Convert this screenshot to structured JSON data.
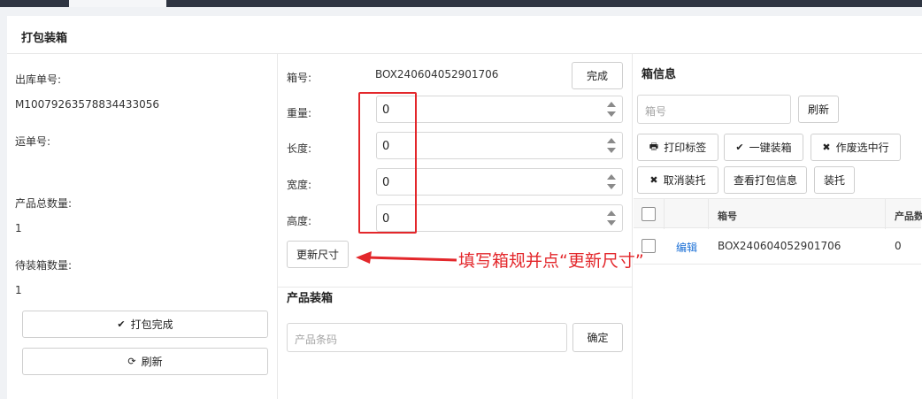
{
  "page": {
    "title": "打包装箱"
  },
  "left": {
    "outbound_label": "出库单号:",
    "outbound_value": "M100792635788344330​56",
    "waybill_label": "运单号:",
    "waybill_value": "",
    "total_qty_label": "产品总数量:",
    "total_qty_value": "1",
    "pending_qty_label": "待装箱数量:",
    "pending_qty_value": "1",
    "pack_done_label": "打包完成",
    "refresh_label": "刷新"
  },
  "box": {
    "box_no_label": "箱号:",
    "box_no_value": "BOX240604052901706",
    "complete_label": "完成",
    "weight_label": "重量:",
    "weight_value": "0",
    "length_label": "长度:",
    "length_value": "0",
    "width_label": "宽度:",
    "width_value": "0",
    "height_label": "高度:",
    "height_value": "0",
    "update_size_label": "更新尺寸"
  },
  "annotation": {
    "text": "填写箱规并点“更新尺寸”",
    "color": "#e3272b"
  },
  "product_packing": {
    "title": "产品装箱",
    "barcode_placeholder": "产品条码",
    "confirm_label": "确定"
  },
  "box_info": {
    "title": "箱信息",
    "box_no_placeholder": "箱号",
    "refresh_label": "刷新",
    "print_label_btn": "打印标签",
    "one_click_pack_btn": "一键装箱",
    "void_selected_btn": "作废选中行",
    "cancel_pack_btn": "取消装托",
    "view_pack_info_btn": "查看打包信息",
    "palletize_btn": "装托",
    "table": {
      "headers": [
        "",
        "",
        "箱号",
        "产品数"
      ],
      "rows": [
        {
          "action": "编辑",
          "box_no": "BOX240604052901706",
          "qty": "0"
        }
      ]
    }
  },
  "colors": {
    "accent_link": "#1a6fd6",
    "annotation_red": "#e3272b"
  }
}
